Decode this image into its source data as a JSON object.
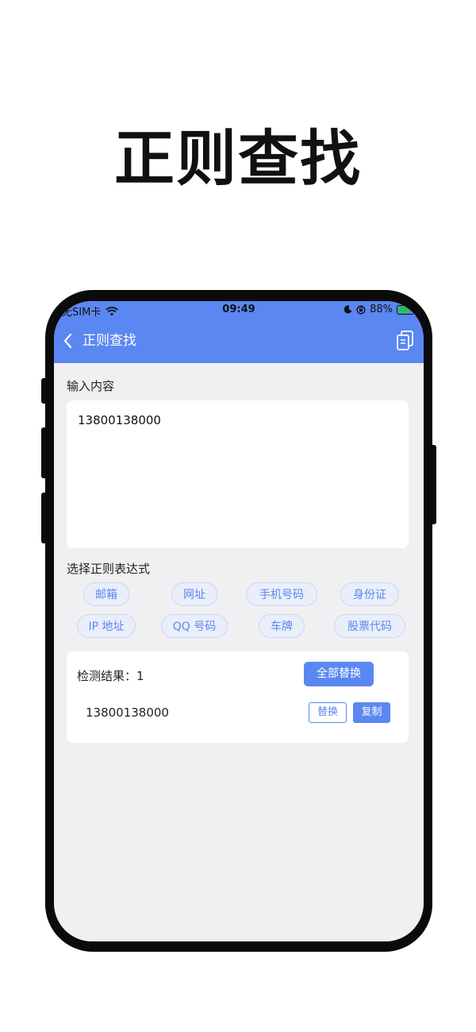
{
  "promo": {
    "title": "正则查找"
  },
  "status_bar": {
    "carrier": "无SIM卡",
    "time": "09:49",
    "battery": "88%",
    "battery_level": 0.88
  },
  "nav": {
    "title": "正则查找"
  },
  "input_section": {
    "label": "输入内容",
    "value": "13800138000"
  },
  "regex_section": {
    "label": "选择正则表达式",
    "options": [
      "邮箱",
      "网址",
      "手机号码",
      "身份证",
      "IP 地址",
      "QQ 号码",
      "车牌",
      "股票代码"
    ]
  },
  "results": {
    "count_label": "检测结果：1",
    "replace_all_label": "全部替换",
    "items": [
      {
        "text": "13800138000",
        "replace_label": "替换",
        "copy_label": "复制"
      }
    ]
  },
  "colors": {
    "accent": "#5b87f2",
    "background": "#f0f0f3"
  }
}
